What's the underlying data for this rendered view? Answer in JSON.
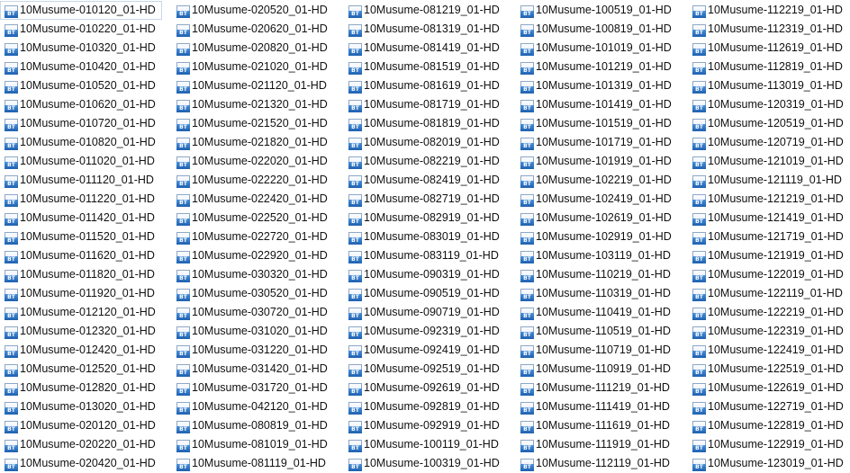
{
  "icon": {
    "name": "bt-file-icon",
    "badge": "BT",
    "badge_color": "#2f76c8"
  },
  "columns": [
    [
      "10Musume-010120_01-HD",
      "10Musume-010220_01-HD",
      "10Musume-010320_01-HD",
      "10Musume-010420_01-HD",
      "10Musume-010520_01-HD",
      "10Musume-010620_01-HD",
      "10Musume-010720_01-HD",
      "10Musume-010820_01-HD",
      "10Musume-011020_01-HD",
      "10Musume-011120_01-HD",
      "10Musume-011220_01-HD",
      "10Musume-011420_01-HD",
      "10Musume-011520_01-HD",
      "10Musume-011620_01-HD",
      "10Musume-011820_01-HD",
      "10Musume-011920_01-HD",
      "10Musume-012120_01-HD",
      "10Musume-012320_01-HD",
      "10Musume-012420_01-HD",
      "10Musume-012520_01-HD",
      "10Musume-012820_01-HD",
      "10Musume-013020_01-HD",
      "10Musume-020120_01-HD",
      "10Musume-020220_01-HD",
      "10Musume-020420_01-HD"
    ],
    [
      "10Musume-020520_01-HD",
      "10Musume-020620_01-HD",
      "10Musume-020820_01-HD",
      "10Musume-021020_01-HD",
      "10Musume-021120_01-HD",
      "10Musume-021320_01-HD",
      "10Musume-021520_01-HD",
      "10Musume-021820_01-HD",
      "10Musume-022020_01-HD",
      "10Musume-022220_01-HD",
      "10Musume-022420_01-HD",
      "10Musume-022520_01-HD",
      "10Musume-022720_01-HD",
      "10Musume-022920_01-HD",
      "10Musume-030320_01-HD",
      "10Musume-030520_01-HD",
      "10Musume-030720_01-HD",
      "10Musume-031020_01-HD",
      "10Musume-031220_01-HD",
      "10Musume-031420_01-HD",
      "10Musume-031720_01-HD",
      "10Musume-042120_01-HD",
      "10Musume-080819_01-HD",
      "10Musume-081019_01-HD",
      "10Musume-081119_01-HD"
    ],
    [
      "10Musume-081219_01-HD",
      "10Musume-081319_01-HD",
      "10Musume-081419_01-HD",
      "10Musume-081519_01-HD",
      "10Musume-081619_01-HD",
      "10Musume-081719_01-HD",
      "10Musume-081819_01-HD",
      "10Musume-082019_01-HD",
      "10Musume-082219_01-HD",
      "10Musume-082419_01-HD",
      "10Musume-082719_01-HD",
      "10Musume-082919_01-HD",
      "10Musume-083019_01-HD",
      "10Musume-083119_01-HD",
      "10Musume-090319_01-HD",
      "10Musume-090519_01-HD",
      "10Musume-090719_01-HD",
      "10Musume-092319_01-HD",
      "10Musume-092419_01-HD",
      "10Musume-092519_01-HD",
      "10Musume-092619_01-HD",
      "10Musume-092819_01-HD",
      "10Musume-092919_01-HD",
      "10Musume-100119_01-HD",
      "10Musume-100319_01-HD"
    ],
    [
      "10Musume-100519_01-HD",
      "10Musume-100819_01-HD",
      "10Musume-101019_01-HD",
      "10Musume-101219_01-HD",
      "10Musume-101319_01-HD",
      "10Musume-101419_01-HD",
      "10Musume-101519_01-HD",
      "10Musume-101719_01-HD",
      "10Musume-101919_01-HD",
      "10Musume-102219_01-HD",
      "10Musume-102419_01-HD",
      "10Musume-102619_01-HD",
      "10Musume-102919_01-HD",
      "10Musume-103119_01-HD",
      "10Musume-110219_01-HD",
      "10Musume-110319_01-HD",
      "10Musume-110419_01-HD",
      "10Musume-110519_01-HD",
      "10Musume-110719_01-HD",
      "10Musume-110919_01-HD",
      "10Musume-111219_01-HD",
      "10Musume-111419_01-HD",
      "10Musume-111619_01-HD",
      "10Musume-111919_01-HD",
      "10Musume-112119_01-HD"
    ],
    [
      "10Musume-112219_01-HD",
      "10Musume-112319_01-HD",
      "10Musume-112619_01-HD",
      "10Musume-112819_01-HD",
      "10Musume-113019_01-HD",
      "10Musume-120319_01-HD",
      "10Musume-120519_01-HD",
      "10Musume-120719_01-HD",
      "10Musume-121019_01-HD",
      "10Musume-121119_01-HD",
      "10Musume-121219_01-HD",
      "10Musume-121419_01-HD",
      "10Musume-121719_01-HD",
      "10Musume-121919_01-HD",
      "10Musume-122019_01-HD",
      "10Musume-122119_01-HD",
      "10Musume-122219_01-HD",
      "10Musume-122319_01-HD",
      "10Musume-122419_01-HD",
      "10Musume-122519_01-HD",
      "10Musume-122619_01-HD",
      "10Musume-122719_01-HD",
      "10Musume-122819_01-HD",
      "10Musume-122919_01-HD",
      "10Musume-123019_01-HD"
    ]
  ]
}
